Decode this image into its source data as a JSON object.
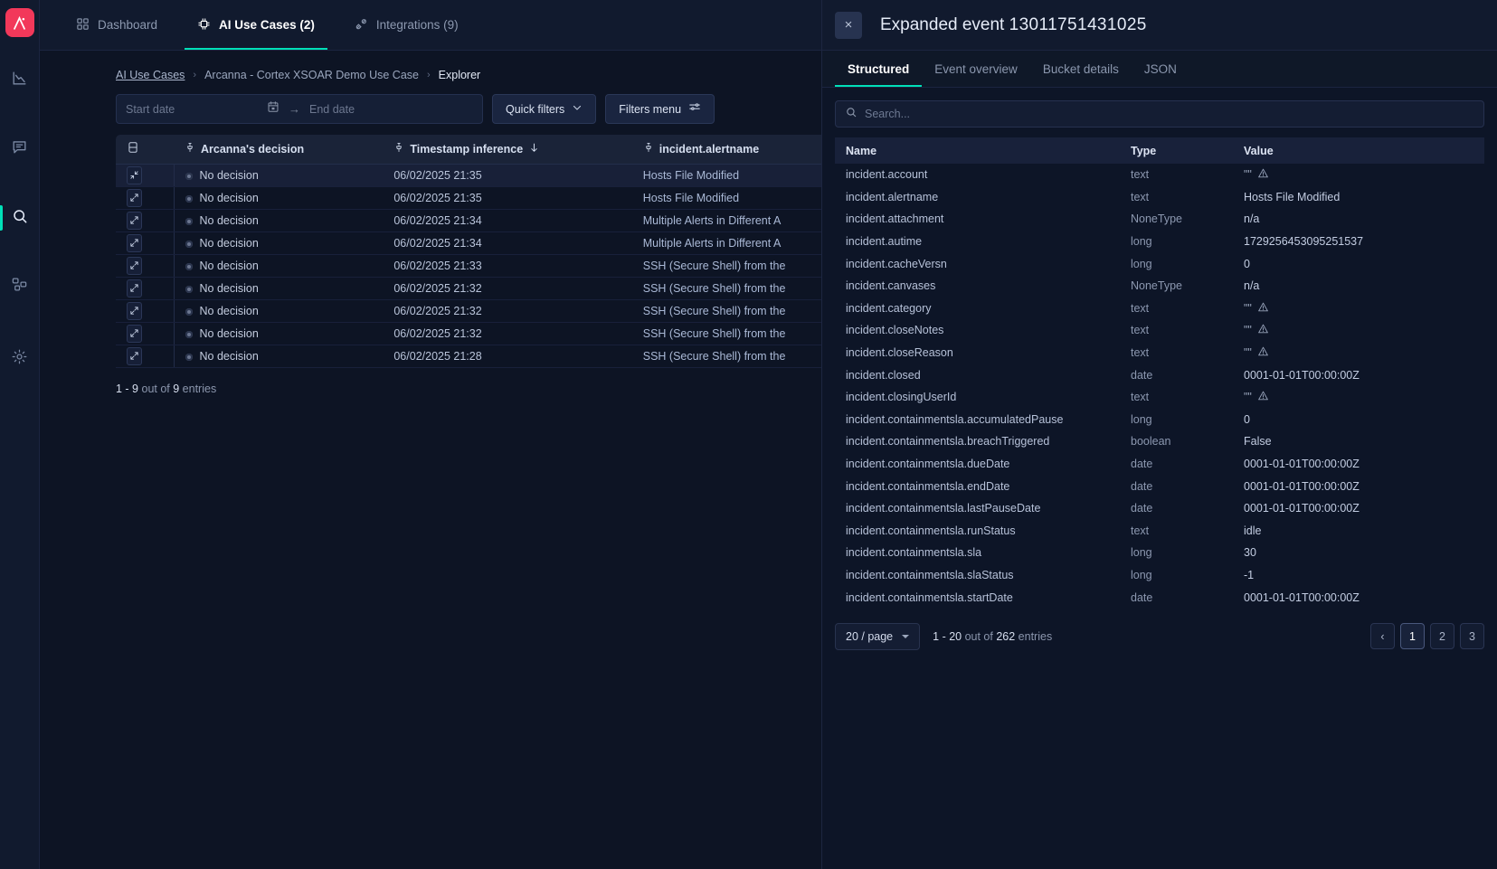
{
  "colors": {
    "accent": "#00e0b8",
    "brand": "#f2385a",
    "bg": "#0d1424",
    "panel_bg": "#0d1527"
  },
  "rail": {
    "logo_text": "Ai",
    "items": [
      {
        "icon": "chart-line-icon",
        "name": "analytics"
      },
      {
        "icon": "comment-icon",
        "name": "feedback"
      },
      {
        "icon": "search-icon",
        "name": "explorer"
      },
      {
        "icon": "nodes-icon",
        "name": "integrations"
      },
      {
        "icon": "gear-icon",
        "name": "settings"
      }
    ]
  },
  "topnav": {
    "tabs": [
      {
        "label": "Dashboard",
        "icon": "grid-icon",
        "active": false
      },
      {
        "label": "AI Use Cases (2)",
        "icon": "chip-icon",
        "active": true
      },
      {
        "label": "Integrations (9)",
        "icon": "plug-icon",
        "active": false
      }
    ]
  },
  "breadcrumb": {
    "root": "AI Use Cases",
    "middle": "Arcanna - Cortex XSOAR Demo Use Case",
    "current": "Explorer",
    "separator": "›"
  },
  "filters": {
    "start_date_placeholder": "Start date",
    "end_date_placeholder": "End date",
    "start_date_value": "",
    "end_date_value": "",
    "range_arrow": "→",
    "quick_filters_label": "Quick filters",
    "filters_menu_label": "Filters menu"
  },
  "events_table": {
    "columns": [
      "",
      "Arcanna's decision",
      "Timestamp inference",
      "incident.alertname"
    ],
    "sort_column": "Timestamp inference",
    "sort_direction": "desc",
    "rows": [
      {
        "decision": "No decision",
        "timestamp": "06/02/2025 21:35",
        "alertname": "Hosts File Modified",
        "expanded": true
      },
      {
        "decision": "No decision",
        "timestamp": "06/02/2025 21:35",
        "alertname": "Hosts File Modified",
        "expanded": false
      },
      {
        "decision": "No decision",
        "timestamp": "06/02/2025 21:34",
        "alertname": "Multiple Alerts in Different A",
        "expanded": false
      },
      {
        "decision": "No decision",
        "timestamp": "06/02/2025 21:34",
        "alertname": "Multiple Alerts in Different A",
        "expanded": false
      },
      {
        "decision": "No decision",
        "timestamp": "06/02/2025 21:33",
        "alertname": "SSH (Secure Shell) from the",
        "expanded": false
      },
      {
        "decision": "No decision",
        "timestamp": "06/02/2025 21:32",
        "alertname": "SSH (Secure Shell) from the",
        "expanded": false
      },
      {
        "decision": "No decision",
        "timestamp": "06/02/2025 21:32",
        "alertname": "SSH (Secure Shell) from the",
        "expanded": false
      },
      {
        "decision": "No decision",
        "timestamp": "06/02/2025 21:32",
        "alertname": "SSH (Secure Shell) from the",
        "expanded": false
      },
      {
        "decision": "No decision",
        "timestamp": "06/02/2025 21:28",
        "alertname": "SSH (Secure Shell) from the",
        "expanded": false
      }
    ],
    "entries_range": "1 - 9",
    "entries_mid": " out of ",
    "entries_total": "9",
    "entries_suffix": " entries"
  },
  "panel": {
    "close_label": "×",
    "title_prefix": "Expanded event",
    "event_id": "13011751431025",
    "tabs": [
      {
        "label": "Structured",
        "active": true
      },
      {
        "label": "Event overview",
        "active": false
      },
      {
        "label": "Bucket details",
        "active": false
      },
      {
        "label": "JSON",
        "active": false
      }
    ],
    "search_placeholder": "Search...",
    "search_value": "",
    "columns": [
      "Name",
      "Type",
      "Value"
    ],
    "rows": [
      {
        "name": "incident.account",
        "type": "text",
        "value": "\"\"",
        "warn": true
      },
      {
        "name": "incident.alertname",
        "type": "text",
        "value": "Hosts File Modified",
        "warn": false
      },
      {
        "name": "incident.attachment",
        "type": "NoneType",
        "value": "n/a",
        "warn": false
      },
      {
        "name": "incident.autime",
        "type": "long",
        "value": "1729256453095251537",
        "warn": false
      },
      {
        "name": "incident.cacheVersn",
        "type": "long",
        "value": "0",
        "warn": false
      },
      {
        "name": "incident.canvases",
        "type": "NoneType",
        "value": "n/a",
        "warn": false
      },
      {
        "name": "incident.category",
        "type": "text",
        "value": "\"\"",
        "warn": true
      },
      {
        "name": "incident.closeNotes",
        "type": "text",
        "value": "\"\"",
        "warn": true
      },
      {
        "name": "incident.closeReason",
        "type": "text",
        "value": "\"\"",
        "warn": true
      },
      {
        "name": "incident.closed",
        "type": "date",
        "value": "0001-01-01T00:00:00Z",
        "warn": false
      },
      {
        "name": "incident.closingUserId",
        "type": "text",
        "value": "\"\"",
        "warn": true
      },
      {
        "name": "incident.containmentsla.accumulatedPause",
        "type": "long",
        "value": "0",
        "warn": false
      },
      {
        "name": "incident.containmentsla.breachTriggered",
        "type": "boolean",
        "value": "False",
        "warn": false
      },
      {
        "name": "incident.containmentsla.dueDate",
        "type": "date",
        "value": "0001-01-01T00:00:00Z",
        "warn": false
      },
      {
        "name": "incident.containmentsla.endDate",
        "type": "date",
        "value": "0001-01-01T00:00:00Z",
        "warn": false
      },
      {
        "name": "incident.containmentsla.lastPauseDate",
        "type": "date",
        "value": "0001-01-01T00:00:00Z",
        "warn": false
      },
      {
        "name": "incident.containmentsla.runStatus",
        "type": "text",
        "value": "idle",
        "warn": false
      },
      {
        "name": "incident.containmentsla.sla",
        "type": "long",
        "value": "30",
        "warn": false
      },
      {
        "name": "incident.containmentsla.slaStatus",
        "type": "long",
        "value": "-1",
        "warn": false
      },
      {
        "name": "incident.containmentsla.startDate",
        "type": "date",
        "value": "0001-01-01T00:00:00Z",
        "warn": false
      }
    ],
    "pager": {
      "per_page": "20 / page",
      "entries_range": "1 - 20",
      "entries_mid": " out of ",
      "entries_total": "262",
      "entries_suffix": " entries",
      "prev_label": "‹",
      "pages": [
        "1",
        "2",
        "3"
      ],
      "current_page": "1"
    }
  }
}
